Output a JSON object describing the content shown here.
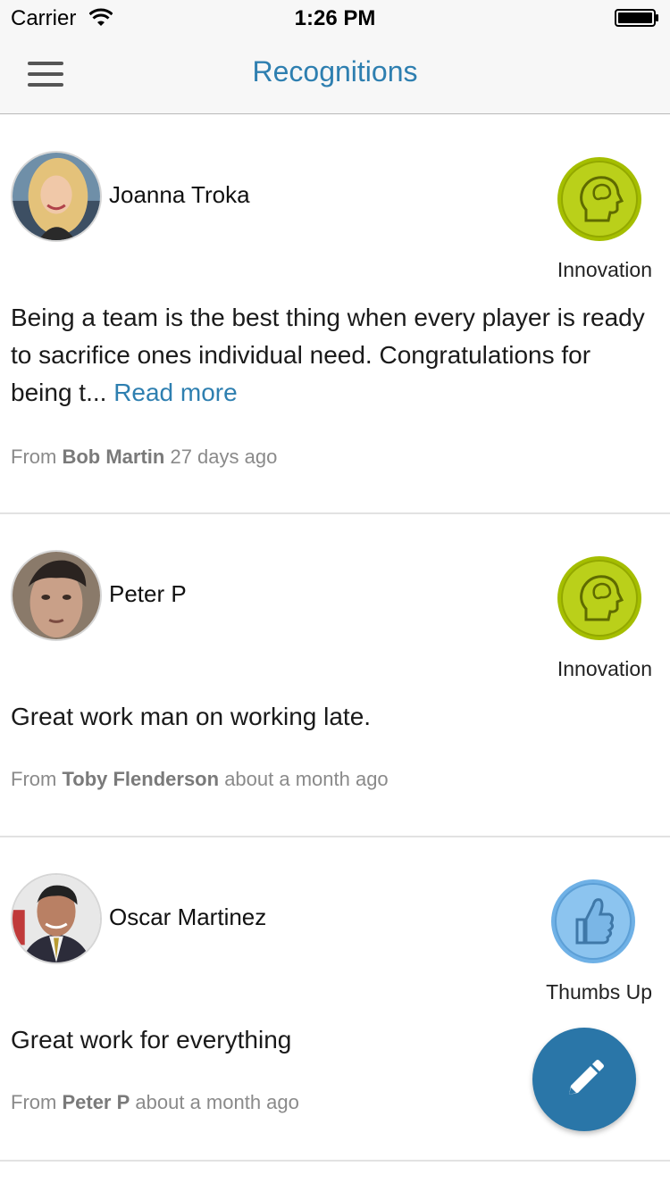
{
  "status_bar": {
    "carrier": "Carrier",
    "time": "1:26 PM"
  },
  "nav": {
    "title": "Recognitions",
    "menu_icon": "hamburger-menu-icon"
  },
  "colors": {
    "accent": "#2e7fb0",
    "fab": "#2a76a8",
    "innovation_badge": "#a5be00",
    "thumbs_badge": "#6fb1e6"
  },
  "recognitions": [
    {
      "recipient": "Joanna Troka",
      "badge": {
        "label": "Innovation",
        "icon": "brain-head-icon"
      },
      "message": "Being a team is the best thing when every player is ready to sacrifice ones individual need. Congratulations for being t...",
      "read_more": "Read more",
      "from_label": "From",
      "sender": "Bob Martin",
      "time_ago": "27 days ago"
    },
    {
      "recipient": "Peter P",
      "badge": {
        "label": "Innovation",
        "icon": "brain-head-icon"
      },
      "message": "Great work man on working late.",
      "from_label": "From",
      "sender": "Toby Flenderson",
      "time_ago": "about a month ago"
    },
    {
      "recipient": "Oscar Martinez",
      "badge": {
        "label": "Thumbs Up",
        "icon": "thumbs-up-icon"
      },
      "message": "Great work for everything",
      "from_label": "From",
      "sender": "Peter P",
      "time_ago": "about a month ago"
    }
  ],
  "fab": {
    "icon": "pencil-icon"
  }
}
